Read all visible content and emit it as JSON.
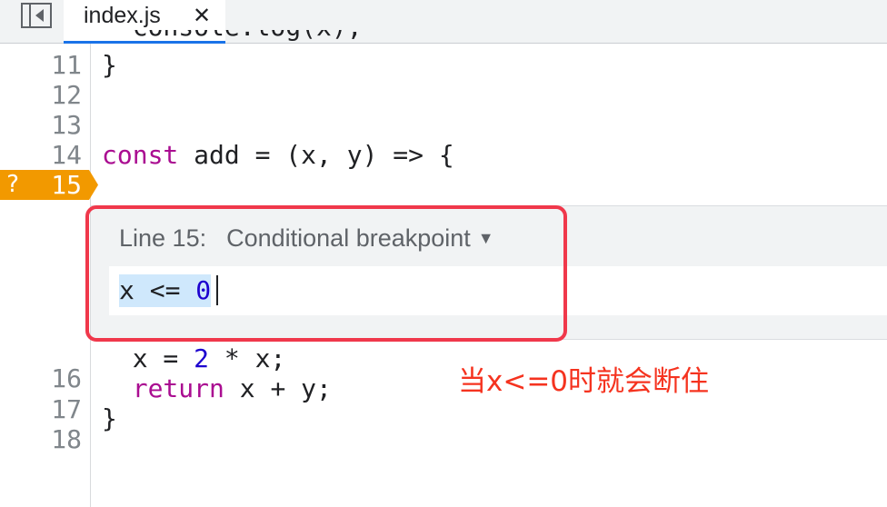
{
  "tab": {
    "title": "index.js",
    "close_glyph": "✕"
  },
  "icons": {
    "panel_toggle": "sidebar-toggle-icon",
    "close": "close-icon",
    "dropdown": "triangle-down-icon"
  },
  "colors": {
    "breakpoint_marker": "#f29900",
    "highlight_box": "#f0384b",
    "annotation": "#f5331f",
    "keyword": "#aa0d91",
    "number": "#1c00cf",
    "selection": "#cfe8fc",
    "active_tab_underline": "#1a73e8"
  },
  "editor": {
    "cut_line": "  console.log(x);",
    "line_numbers": {
      "l11": "11",
      "l12": "12",
      "l13": "13",
      "l14": "14",
      "l16": "16",
      "l17": "17",
      "l18": "18"
    },
    "code": {
      "l11": "}",
      "l14_kw": "const",
      "l14_rest": " add = (x, y) => {",
      "l15a_pre": "  x = ",
      "l15a_num": "2",
      "l15a_post": " * x;",
      "l16_indent": "  ",
      "l16_kw": "return",
      "l16_rest": " x + y;",
      "l17": "}"
    }
  },
  "breakpoint": {
    "marker_glyph": "?",
    "line_number": "15"
  },
  "conditional_breakpoint": {
    "line_label": "Line 15:",
    "type_label": "Conditional breakpoint",
    "dropdown_arrow": "▼",
    "condition_pre": "x <= ",
    "condition_num": "0"
  },
  "annotation": {
    "text": "当x<=0时就会断住"
  }
}
